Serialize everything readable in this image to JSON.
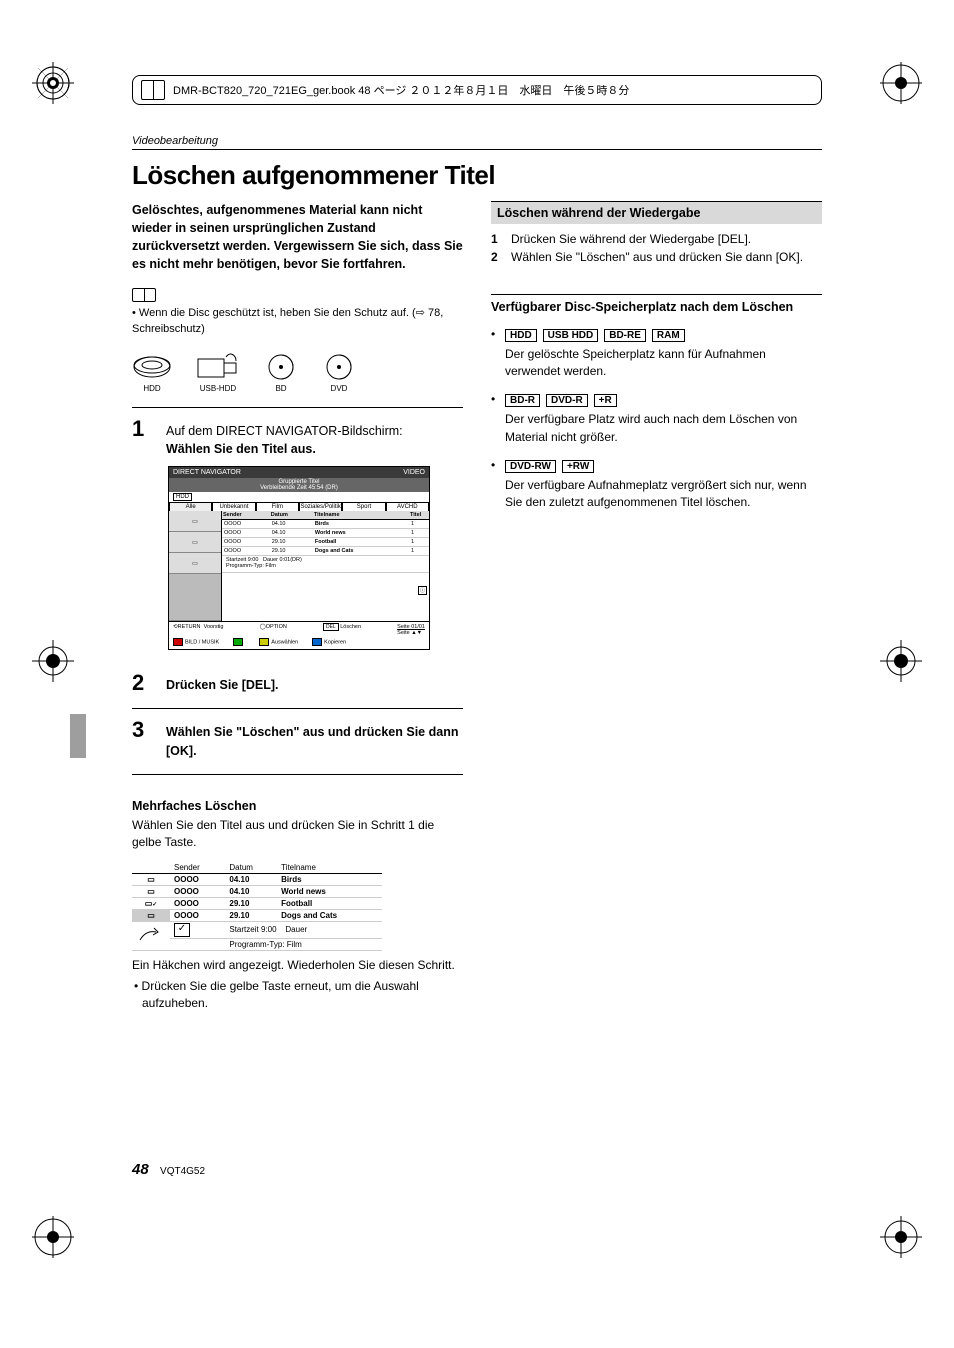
{
  "header": {
    "bookfile": "DMR-BCT820_720_721EG_ger.book  48 ページ  ２０１２年８月１日　水曜日　午後５時８分"
  },
  "section_label": "Videobearbeitung",
  "title": "Löschen aufgenommener Titel",
  "left": {
    "intro": "Gelöschtes, aufgenommenes Material kann nicht wieder in seinen ursprünglichen Zustand zurückversetzt werden. Vergewissern Sie sich, dass Sie es nicht mehr benötigen, bevor Sie fortfahren.",
    "note": "• Wenn die Disc geschützt ist, heben Sie den Schutz auf. (⇨ 78, Schreibschutz)",
    "media": {
      "hdd": "HDD",
      "usbhdd": "USB-HDD",
      "bd": "BD",
      "dvd": "DVD"
    },
    "step1": {
      "line1": "Auf dem DIRECT NAVIGATOR-Bildschirm:",
      "line2": "Wählen Sie den Titel aus."
    },
    "screenshot": {
      "title": "DIRECT NAVIGATOR",
      "subtitle": "Gruppierte Titel",
      "subtitle2": "Verbleibende Zeit  45:54 (DR)",
      "video": "VIDEO",
      "hdd": "HDD",
      "tabs": [
        "Alle",
        "Unbekannt",
        "Film",
        "Soziales/Politik",
        "Sport",
        "AVCHD"
      ],
      "cols": [
        "Sender",
        "Datum",
        "Titelname"
      ],
      "rows": [
        {
          "ch": "OOOO",
          "dt": "04.10",
          "tn": "Birds"
        },
        {
          "ch": "OOOO",
          "dt": "04.10",
          "tn": "World news"
        },
        {
          "ch": "OOOO",
          "dt": "29.10",
          "tn": "Football"
        },
        {
          "ch": "OOOO",
          "dt": "29.10",
          "tn": "Dogs and Cats"
        }
      ],
      "meta": {
        "start": "Startzeit  9:00",
        "dauer": "Dauer  0:01(DR)",
        "typ": "Programm-Typ: Film"
      },
      "side": "Titel",
      "foot": {
        "return": "RETURN",
        "voorstig": "Voorstig",
        "option": "OPTION",
        "delete_label": "Löschen",
        "delete_key": "DEL",
        "page": "Seite 01/01",
        "seite": "Seite"
      },
      "foot2": {
        "bild": "BILD / MUSIK",
        "aus": "Auswählen",
        "kop": "Kopieren"
      }
    },
    "step2": "Drücken Sie [DEL].",
    "step3": "Wählen Sie \"Löschen\" aus und drücken Sie dann [OK].",
    "multi_head": "Mehrfaches Löschen",
    "multi_text": "Wählen Sie den Titel aus und drücken Sie in Schritt 1 die gelbe Taste.",
    "mini": {
      "cols": [
        "Sender",
        "Datum",
        "Titelname"
      ],
      "rows": [
        {
          "ch": "OOOO",
          "dt": "04.10",
          "tn": "Birds"
        },
        {
          "ch": "OOOO",
          "dt": "04.10",
          "tn": "World news"
        },
        {
          "ch": "OOOO",
          "dt": "29.10",
          "tn": "Football"
        },
        {
          "ch": "OOOO",
          "dt": "29.10",
          "tn": "Dogs and Cats"
        }
      ],
      "meta_start": "Startzeit  9:00",
      "meta_dauer": "Dauer",
      "meta_typ": "Programm-Typ: Film",
      "check": "✓"
    },
    "multi_after": "Ein Häkchen wird angezeigt. Wiederholen Sie diesen Schritt.",
    "multi_bullet": "• Drücken Sie die gelbe Taste erneut, um die Auswahl aufzuheben."
  },
  "right": {
    "band": "Löschen während der Wiedergabe",
    "steps": [
      "Drücken Sie während der Wiedergabe [DEL].",
      "Wählen Sie \"Löschen\" aus und drücken Sie dann [OK]."
    ],
    "avail_head": "Verfügbarer Disc-Speicherplatz nach dem Löschen",
    "group1": {
      "discs": [
        "HDD",
        "USB HDD",
        "BD-RE",
        "RAM"
      ],
      "text": "Der gelöschte Speicherplatz kann für Aufnahmen verwendet werden."
    },
    "group2": {
      "discs": [
        "BD-R",
        "DVD-R",
        "+R"
      ],
      "text": "Der verfügbare Platz wird auch nach dem Löschen von Material nicht größer."
    },
    "group3": {
      "discs": [
        "DVD-RW",
        "+RW"
      ],
      "text": "Der verfügbare Aufnahmeplatz vergrößert sich nur, wenn Sie den zuletzt aufgenommenen Titel löschen."
    }
  },
  "footer": {
    "page": "48",
    "code": "VQT4G52"
  }
}
